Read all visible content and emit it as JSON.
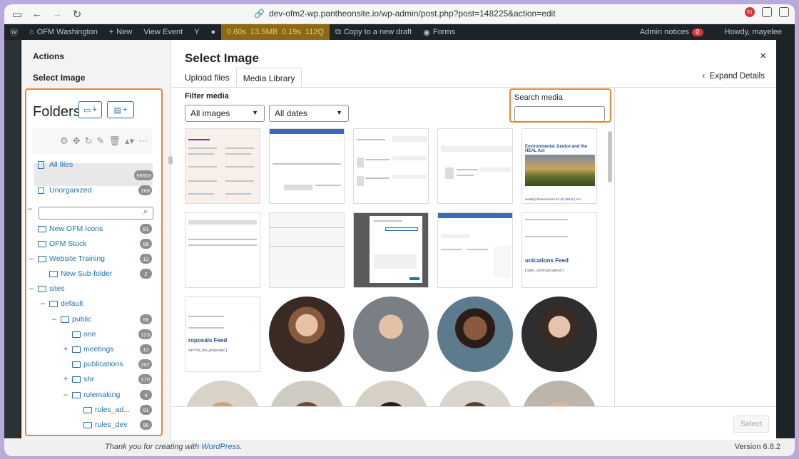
{
  "browser": {
    "url": "dev-ofm2-wp.pantheonsite.io/wp-admin/post.php?post=148225&action=edit",
    "ext_badge": "51"
  },
  "adminbar": {
    "site": "OFM Washington",
    "new": "New",
    "view": "View Event",
    "metrics": [
      "0.60s",
      "13.5MB",
      "0.19s",
      "112Q"
    ],
    "copy": "Copy to a new draft",
    "forms": "Forms",
    "notices": "Admin notices",
    "notices_count": "0",
    "howdy": "Howdy, mayelee"
  },
  "footer": {
    "thanks_prefix": "Thank you for creating with",
    "thanks_link": "WordPress",
    "thanks_suffix": ".",
    "version": "Version 6.8.2"
  },
  "left_panel": {
    "actions": "Actions",
    "select_image": "Select Image",
    "folders_title": "Folders",
    "new_folder_btn": "+",
    "move_btn": "+",
    "all_files": "All files",
    "all_files_count": "99553",
    "unorganized": "Unorganized",
    "unorganized_count": "269",
    "folders": [
      {
        "label": "New OFM Icons",
        "count": "81",
        "toggle": ""
      },
      {
        "label": "OFM Stock",
        "count": "98",
        "toggle": ""
      },
      {
        "label": "Website Training",
        "count": "12",
        "toggle": "–"
      },
      {
        "label": "New Sub-folder",
        "count": "2",
        "toggle": ""
      },
      {
        "label": "sites",
        "count": "",
        "toggle": "–"
      },
      {
        "label": "default",
        "count": "",
        "toggle": "–"
      },
      {
        "label": "public",
        "count": "56",
        "toggle": "–"
      },
      {
        "label": "one",
        "count": "123",
        "toggle": ""
      },
      {
        "label": "meetings",
        "count": "12",
        "toggle": "+"
      },
      {
        "label": "publications",
        "count": "207",
        "toggle": ""
      },
      {
        "label": "shr",
        "count": "170",
        "toggle": "+"
      },
      {
        "label": "rulemaking",
        "count": "4",
        "toggle": "–"
      },
      {
        "label": "rules_ad...",
        "count": "91",
        "toggle": ""
      },
      {
        "label": "rules_dev",
        "count": "90",
        "toggle": ""
      }
    ]
  },
  "main": {
    "title": "Select Image",
    "close": "×",
    "tabs": [
      "Upload files",
      "Media Library"
    ],
    "expand": "Expand Details",
    "filter_label": "Filter media",
    "filter_type": "All images",
    "filter_date": "All dates",
    "search_label": "Search media",
    "select_button": "Select"
  },
  "thumb_texts": {
    "doc_title_1": "Environmental Justice and the HEAL Act",
    "doc_caption_1": "Healthy Environment for All (HEAL) Act",
    "feed_1": "unications Feed",
    "feed_1_code": "[\"safv_communications\"]",
    "feed_2": "roposals Feed",
    "feed_2_code": "ds=\"fox_fee_proposals\"]"
  },
  "colors": {
    "accent": "#2271b1",
    "highlight": "#e8893a",
    "admin_bg": "#1d2327"
  }
}
